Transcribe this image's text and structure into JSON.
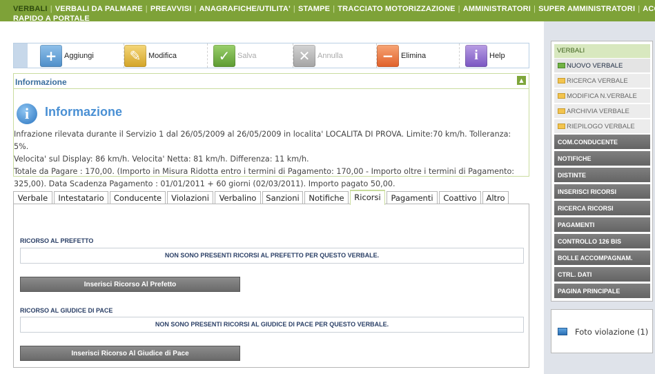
{
  "topnav": {
    "items": [
      "VERBALI",
      "VERBALI DA PALMARE",
      "PREAVVISI",
      "ANAGRAFICHE/UTILITA'",
      "STAMPE",
      "TRACCIATO MOTORIZZAZIONE",
      "AMMINISTRATORI",
      "SUPER AMMINISTRATORI",
      "ACCESSO",
      "RAPIDO A PORTALE"
    ]
  },
  "toolbar": {
    "add": "Aggiungi",
    "edit": "Modifica",
    "save": "Salva",
    "cancel": "Annulla",
    "delete": "Elimina",
    "help": "Help"
  },
  "info": {
    "header": "Informazione",
    "title": "Informazione",
    "line1": "Infrazione rilevata durante il Servizio 1 dal 26/05/2009 al 26/05/2009 in localita' LOCALITA DI PROVA. Limite:70 km/h. Tolleranza: 5%.",
    "line2": "Velocita' sul Display: 86 km/h. Velocita' Netta: 81 km/h. Differenza: 11 km/h.",
    "line3": "Totale da Pagare : 170,00. (Importo in Misura Ridotta entro i termini di Pagamento: 170,00 - Importo oltre i termini di Pagamento:",
    "line4": "325,00). Data Scadenza Pagamento : 01/01/2011 + 60 giorni (02/03/2011). Importo pagato 50,00."
  },
  "tabs": [
    "Verbale",
    "Intestatario",
    "Conducente",
    "Violazioni",
    "Verbalino",
    "Sanzioni",
    "Notifiche",
    "Ricorsi",
    "Pagamenti",
    "Coattivo",
    "Altro"
  ],
  "content": {
    "prefetto_title": "RICORSO AL PREFETTO",
    "prefetto_notice": "NON SONO PRESENTI RICORSI AL PREFETTO PER QUESTO VERBALE.",
    "prefetto_button": "Inserisci Ricorso Al Prefetto",
    "giudice_title": "RICORSO AL GIUDICE DI PACE",
    "giudice_notice": "NON SONO PRESENTI RICORSI AL GIUDICE DI PACE PER QUESTO VERBALE.",
    "giudice_button": "Inserisci Ricorso Al Giudice di Pace"
  },
  "menu": {
    "header": "VERBALI",
    "sub": [
      "NUOVO VERBALE",
      "RICERCA VERBALE",
      "MODIFICA N.VERBALE",
      "ARCHIVIA VERBALE",
      "RIEPILOGO VERBALE"
    ],
    "main": [
      "COM.CONDUCENTE",
      "NOTIFICHE",
      "DISTINTE",
      "INSERISCI RICORSI",
      "RICERCA RICORSI",
      "PAGAMENTI",
      "CONTROLLO 126 BIS",
      "BOLLE ACCOMPAGNAM.",
      "CTRL. DATI",
      "PAGINA PRINCIPALE"
    ]
  },
  "photo": {
    "label": "Foto violazione (1)"
  }
}
